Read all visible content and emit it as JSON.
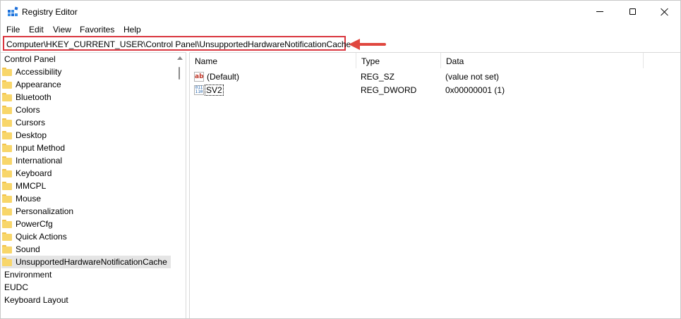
{
  "window": {
    "title": "Registry Editor",
    "icon": "regedit-icon"
  },
  "menu": [
    "File",
    "Edit",
    "View",
    "Favorites",
    "Help"
  ],
  "address": {
    "path": "Computer\\HKEY_CURRENT_USER\\Control Panel\\UnsupportedHardwareNotificationCache",
    "highlight_color": "#d9363e"
  },
  "tree": {
    "items": [
      {
        "label": "Control Panel",
        "folder": false
      },
      {
        "label": "Accessibility",
        "folder": true
      },
      {
        "label": "Appearance",
        "folder": true
      },
      {
        "label": "Bluetooth",
        "folder": true
      },
      {
        "label": "Colors",
        "folder": true
      },
      {
        "label": "Cursors",
        "folder": true
      },
      {
        "label": "Desktop",
        "folder": true
      },
      {
        "label": "Input Method",
        "folder": true
      },
      {
        "label": "International",
        "folder": true
      },
      {
        "label": "Keyboard",
        "folder": true
      },
      {
        "label": "MMCPL",
        "folder": true
      },
      {
        "label": "Mouse",
        "folder": true
      },
      {
        "label": "Personalization",
        "folder": true
      },
      {
        "label": "PowerCfg",
        "folder": true
      },
      {
        "label": "Quick Actions",
        "folder": true
      },
      {
        "label": "Sound",
        "folder": true
      },
      {
        "label": "UnsupportedHardwareNotificationCache",
        "folder": true,
        "selected": true
      },
      {
        "label": "Environment",
        "folder": false
      },
      {
        "label": "EUDC",
        "folder": false
      },
      {
        "label": "Keyboard Layout",
        "folder": false
      }
    ]
  },
  "values": {
    "columns": [
      "Name",
      "Type",
      "Data"
    ],
    "rows": [
      {
        "name": "(Default)",
        "type": "REG_SZ",
        "data": "(value not set)",
        "icon": "string-value-icon"
      },
      {
        "name": "SV2",
        "type": "REG_DWORD",
        "data": "0x00000001 (1)",
        "icon": "binary-value-icon"
      }
    ]
  }
}
